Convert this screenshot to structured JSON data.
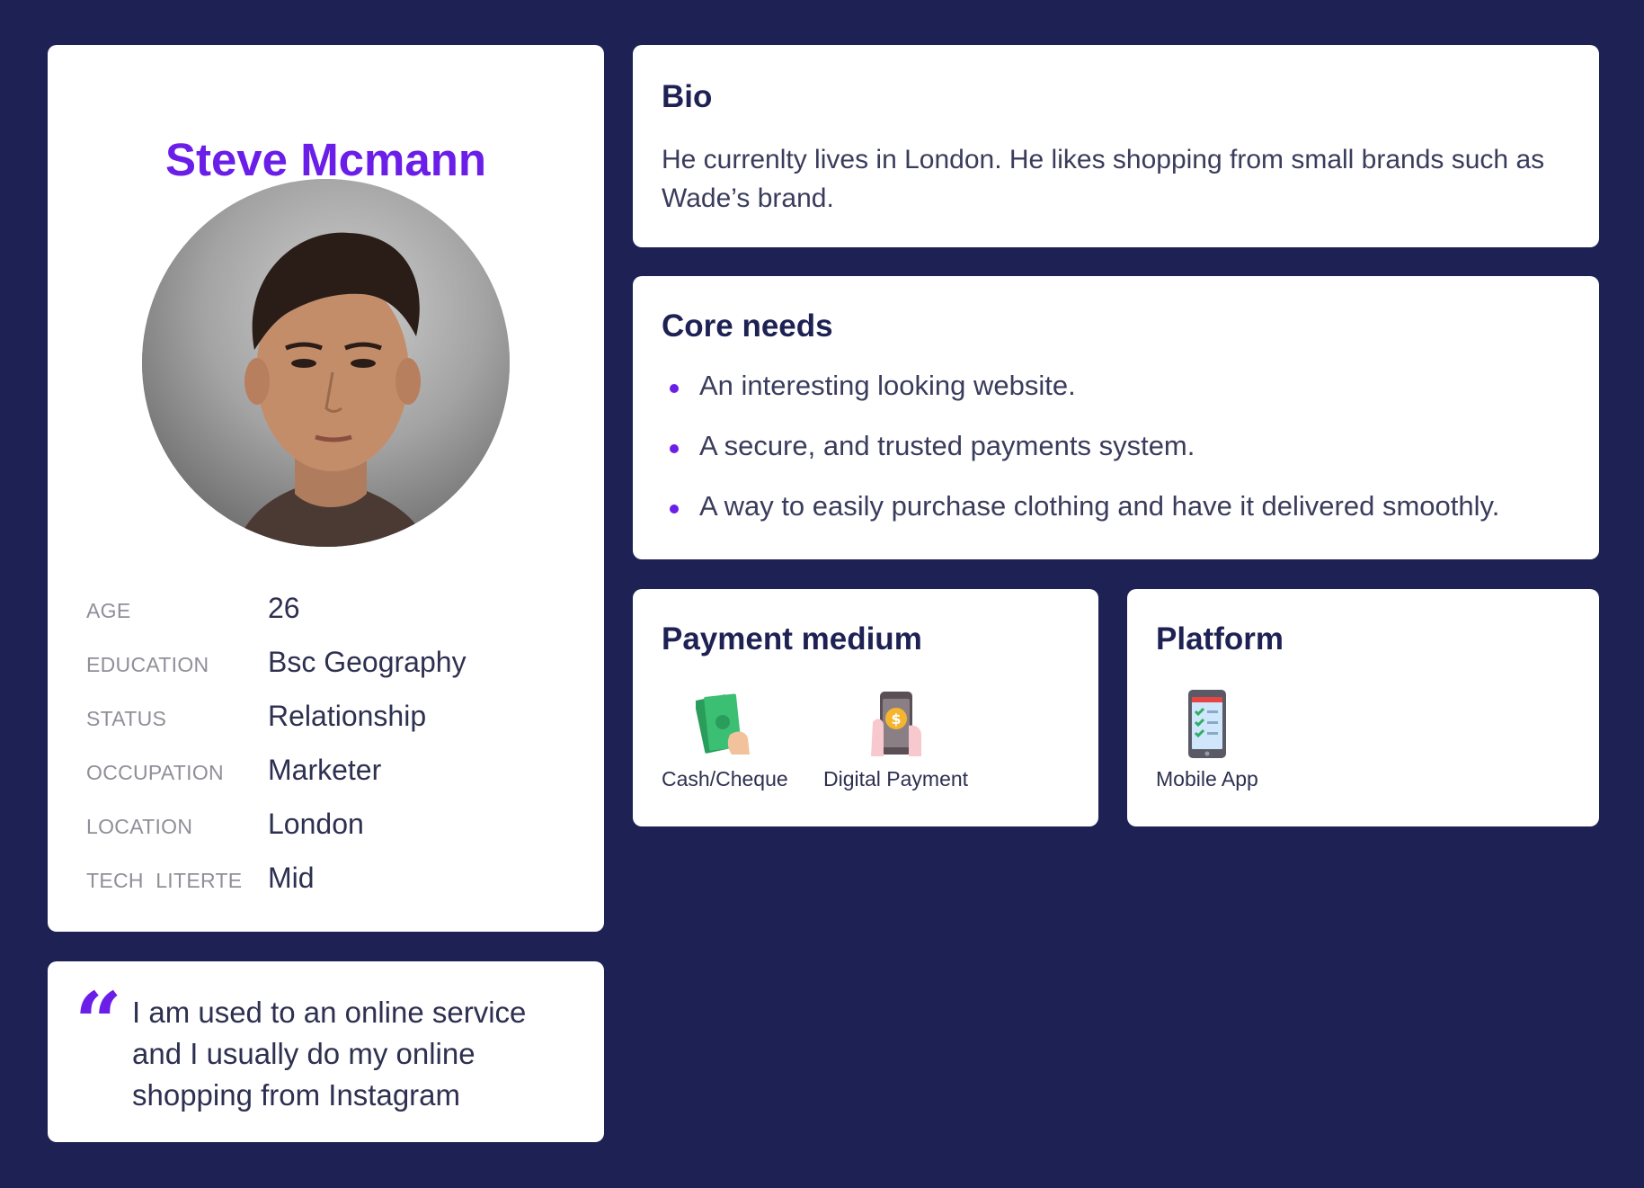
{
  "profile": {
    "name": "Steve Mcmann",
    "facts": [
      {
        "label": "AGE",
        "value": "26"
      },
      {
        "label": "EDUCATION",
        "value": "Bsc Geography"
      },
      {
        "label": "STATUS",
        "value": "Relationship"
      },
      {
        "label": "OCCUPATION",
        "value": "Marketer"
      },
      {
        "label": "LOCATION",
        "value": "London"
      },
      {
        "label": "TECH  LITERTE",
        "value": "Mid"
      }
    ]
  },
  "quote": {
    "text": "I am used to an online service and I usually do my online shopping from Instagram"
  },
  "bio": {
    "title": "Bio",
    "text": "He currenlty lives in London. He likes shopping from small brands such as Wade’s brand."
  },
  "core_needs": {
    "title": "Core needs",
    "items": [
      "An interesting looking website.",
      "A secure, and trusted payments system.",
      "A way to easily purchase clothing and have it delivered smoothly."
    ]
  },
  "payment_medium": {
    "title": "Payment medium",
    "options": [
      {
        "label": "Cash/Cheque",
        "icon": "cash-icon"
      },
      {
        "label": "Digital Payment",
        "icon": "digital-payment-icon"
      }
    ]
  },
  "platform": {
    "title": "Platform",
    "options": [
      {
        "label": "Mobile App",
        "icon": "mobile-app-icon"
      }
    ]
  },
  "colors": {
    "background": "#1e2154",
    "accent": "#6a1ee8",
    "card": "#ffffff"
  }
}
